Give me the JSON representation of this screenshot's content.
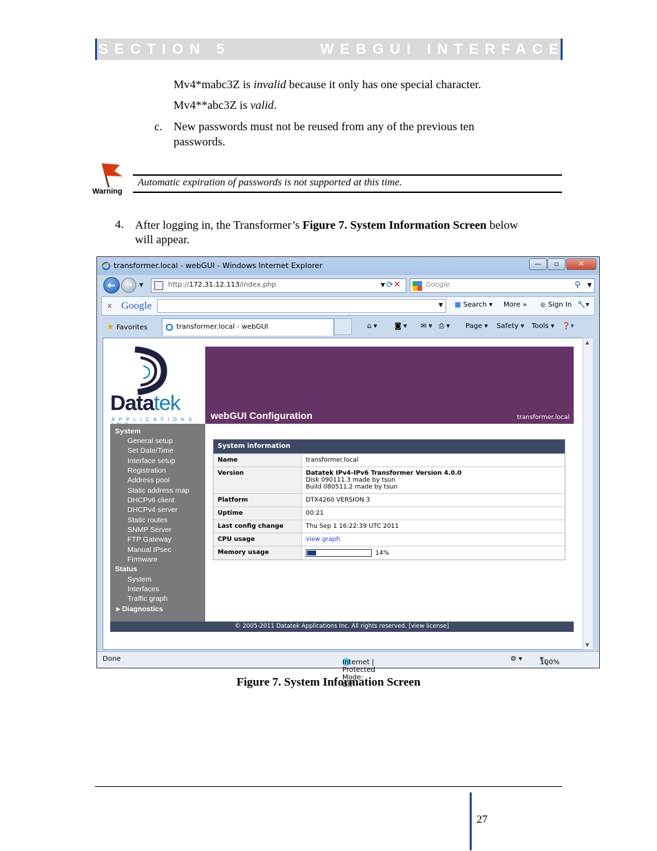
{
  "header": {
    "section": "SECTION 5",
    "title": "WEBGUI INTERFACE"
  },
  "passwords": {
    "line1_prefix": "Mv4*mabc3Z is ",
    "line1_italic": "invalid",
    "line1_suffix": " because it only has one special character.",
    "line2_prefix": "Mv4**abc3Z is ",
    "line2_italic": "valid",
    "line2_suffix": ".",
    "item_c_label": "c.",
    "item_c_text": "New passwords must not be reused from any of the previous ten passwords."
  },
  "warning": {
    "label": "Warning",
    "text": "Automatic expiration of passwords is not supported at this time."
  },
  "step4": {
    "num": "4.",
    "prefix": "After logging in, the Transformer’s ",
    "bold": "Figure 7. System Information Screen",
    "suffix": " below will appear."
  },
  "browser": {
    "title": "transformer.local - webGUI - Windows Internet Explorer",
    "url_prefix": "http://",
    "url_host": "172.31.12.113",
    "url_path": "/index.php",
    "search_placeholder": "Google",
    "google_toolbar": {
      "close": "x",
      "logo": "Google",
      "search": "Search",
      "more": "More »",
      "signin": "Sign In"
    },
    "favorites": "Favorites",
    "tab_title": "transformer.local - webGUI",
    "commands": {
      "page": "Page",
      "safety": "Safety",
      "tools": "Tools"
    },
    "status": {
      "left": "Done",
      "zone": "Internet | Protected Mode: Off",
      "zoom": "100%"
    },
    "colors": {
      "banner": "#663366",
      "table_head": "#3e4a64",
      "sidebar": "#7a7a7a"
    }
  },
  "webgui": {
    "logo": {
      "word1": "Data",
      "word2": "tek",
      "sub": "APPLICATIONS, INC"
    },
    "banner_title": "webGUI Configuration",
    "hostname": "transformer.local",
    "sidebar": {
      "system": "System",
      "system_items": [
        "General setup",
        "Set Date/Time",
        "Interface setup",
        "Registration",
        "Address pool",
        "Static address map",
        "DHCPv6 client",
        "DHCPv4 server",
        "Static routes",
        "SNMP Server",
        "FTP Gateway",
        "Manual IPsec",
        "Firmware"
      ],
      "status": "Status",
      "status_items": [
        "System",
        "Interfaces",
        "Traffic graph"
      ],
      "diagnostics": "Diagnostics"
    },
    "info": {
      "heading": "System information",
      "name_k": "Name",
      "name_v": "transformer.local",
      "version_k": "Version",
      "version_v1": "Datatek IPv4-IPv6 Transformer Version 4.0.0",
      "version_v2": "Disk 090111.3 made by tsun",
      "version_v3": "Build 080511.2 made by tsun",
      "platform_k": "Platform",
      "platform_v": "DTX4260 VERSION 3",
      "uptime_k": "Uptime",
      "uptime_v": "00:21",
      "config_k": "Last config change",
      "config_v": "Thu Sep 1 16:22:39 UTC 2011",
      "cpu_k": "CPU usage",
      "cpu_v": "view graph",
      "mem_k": "Memory usage",
      "mem_v": "14%",
      "mem_fraction": 0.14
    },
    "footer": "© 2005-2011 Datatek Applications Inc. All rights reserved.   [view license]"
  },
  "caption": "Figure 7. System Information Screen",
  "page_number": "27"
}
